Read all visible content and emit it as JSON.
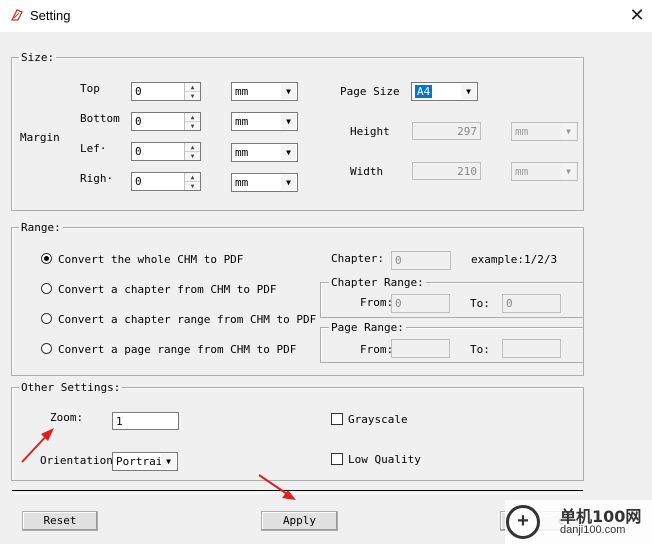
{
  "window": {
    "title": "Setting",
    "close_glyph": "✕"
  },
  "size": {
    "legend": "Size:",
    "margin_label": "Margin",
    "rows": [
      {
        "label": "Top",
        "value": "0",
        "unit": "mm"
      },
      {
        "label": "Bottom",
        "value": "0",
        "unit": "mm"
      },
      {
        "label": "Lef·",
        "value": "0",
        "unit": "mm"
      },
      {
        "label": "Righ·",
        "value": "0",
        "unit": "mm"
      }
    ],
    "page_size_label": "Page Size",
    "page_size_value": "A4",
    "height_label": "Height",
    "height_value": "297",
    "height_unit": "mm",
    "width_label": "Width",
    "width_value": "210",
    "width_unit": "mm"
  },
  "range": {
    "legend": "Range:",
    "options": [
      {
        "label": "Convert the whole CHM to PDF",
        "selected": true
      },
      {
        "label": "Convert a chapter from CHM to PDF",
        "selected": false
      },
      {
        "label": "Convert a chapter range from CHM to PDF",
        "selected": false
      },
      {
        "label": "Convert a page range from CHM to PDF",
        "selected": false
      }
    ],
    "chapter_label": "Chapter:",
    "chapter_value": "0",
    "example_text": "example:1/2/3",
    "chapter_range": {
      "legend": "Chapter Range:",
      "from_label": "From:",
      "from_value": "0",
      "to_label": "To:",
      "to_value": "0"
    },
    "page_range": {
      "legend": "Page Range:",
      "from_label": "From:",
      "from_value": "",
      "to_label": "To:",
      "to_value": ""
    }
  },
  "other": {
    "legend": "Other Settings:",
    "zoom_label": "Zoom:",
    "zoom_value": "1",
    "orientation_label": "Orientation:",
    "orientation_value": "Portrait",
    "grayscale_label": "Grayscale",
    "low_quality_label": "Low Quality"
  },
  "buttons": {
    "reset": "Reset",
    "apply": "Apply",
    "cancel_partial": "el"
  },
  "watermark": {
    "cn": "单机100网",
    "en": "danji100.com"
  },
  "colors": {
    "annotation_arrow": "#e02020",
    "selection": "#0078d7"
  }
}
